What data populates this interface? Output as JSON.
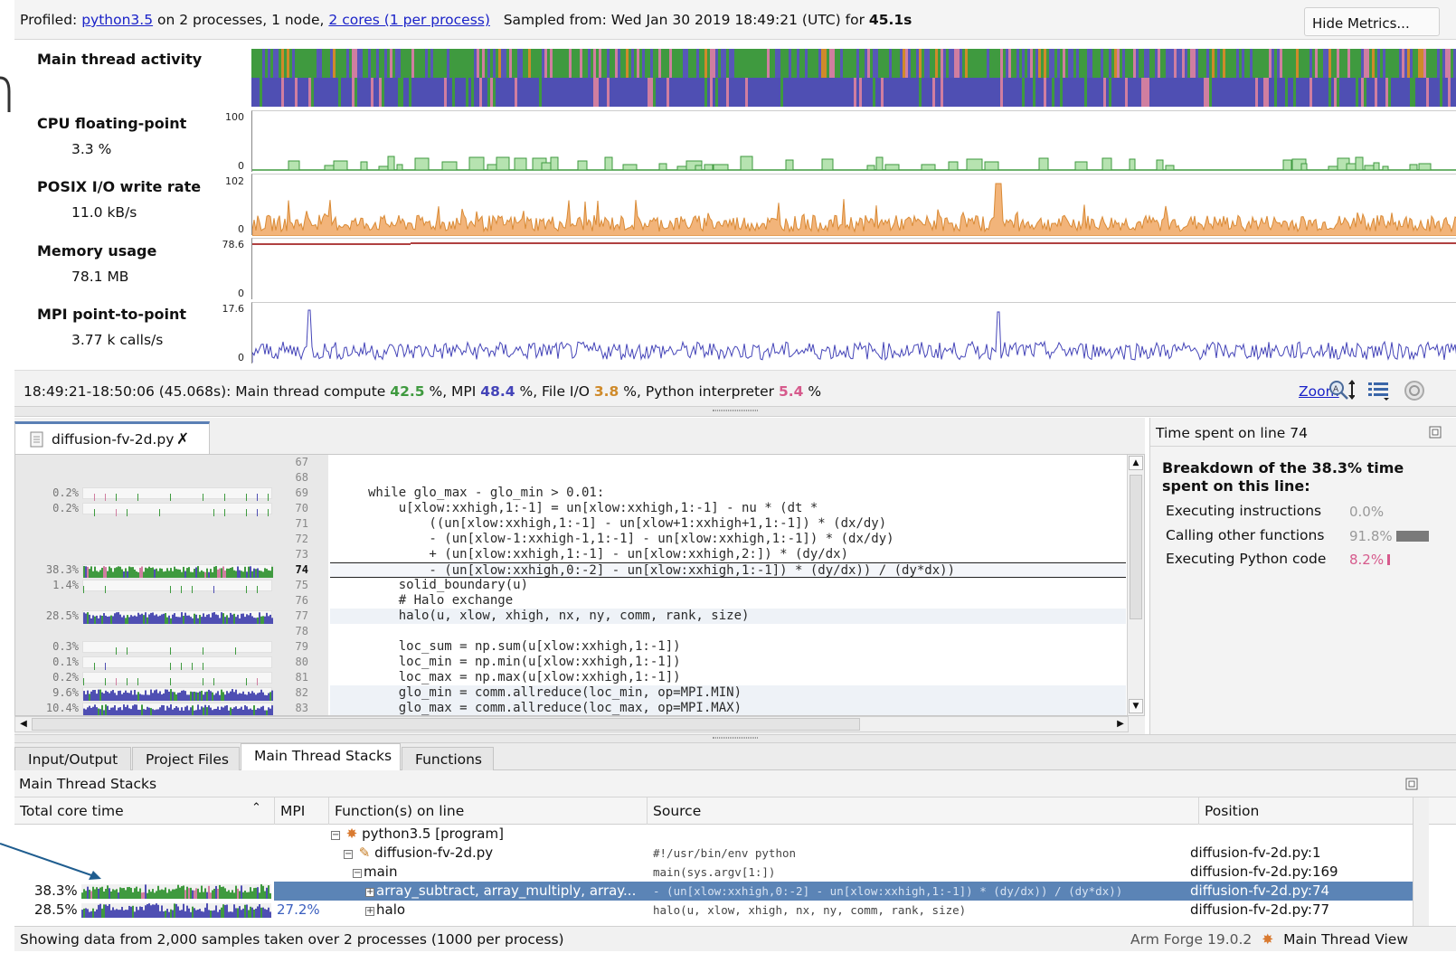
{
  "header": {
    "profiled_label": "Profiled:",
    "program_link": "python3.5",
    "proc_text": "on 2 processes, 1 node,",
    "cores_link": "2 cores (1 per process)",
    "sampled_text": "Sampled from: Wed Jan 30 2019 18:49:21 (UTC) for",
    "duration": "45.1s",
    "hide_metrics_label": "Hide Metrics..."
  },
  "metrics": [
    {
      "title": "Main thread activity",
      "value": "",
      "max": "",
      "min": ""
    },
    {
      "title": "CPU floating-point",
      "value": "3.3 %",
      "max": "100",
      "min": "0"
    },
    {
      "title": "POSIX I/O write rate",
      "value": "11.0 kB/s",
      "max": "102",
      "min": "0"
    },
    {
      "title": "Memory usage",
      "value": "78.1 MB",
      "max": "78.6",
      "min": "0"
    },
    {
      "title": "MPI point-to-point",
      "value": "3.77 k calls/s",
      "max": "17.6",
      "min": "0"
    }
  ],
  "summary": {
    "range": "18:49:21-18:50:06 (45.068s): Main thread compute",
    "compute": "42.5",
    "mpi_label": "%, MPI",
    "mpi": "48.4",
    "io_label": "%, File I/O",
    "io": "3.8",
    "py_label": "%, Python interpreter",
    "py": "5.4",
    "pct_end": "%",
    "zoom_label": "Zoom"
  },
  "editor": {
    "file_tab": "diffusion-fv-2d.py",
    "lines": [
      {
        "no": "67",
        "pct": "",
        "code": ""
      },
      {
        "no": "68",
        "pct": "",
        "code": ""
      },
      {
        "no": "69",
        "pct": "0.2%",
        "code": "while glo_max - glo_min > 0.01:"
      },
      {
        "no": "70",
        "pct": "0.2%",
        "code": "    u[xlow:xxhigh,1:-1] = un[xlow:xxhigh,1:-1] - nu * (dt *"
      },
      {
        "no": "71",
        "pct": "",
        "code": "        ((un[xlow:xxhigh,1:-1] - un[xlow+1:xxhigh+1,1:-1]) * (dx/dy)"
      },
      {
        "no": "72",
        "pct": "",
        "code": "        - (un[xlow-1:xxhigh-1,1:-1] - un[xlow:xxhigh,1:-1]) * (dx/dy)"
      },
      {
        "no": "73",
        "pct": "",
        "code": "        + (un[xlow:xxhigh,1:-1] - un[xlow:xxhigh,2:]) * (dy/dx)"
      },
      {
        "no": "74",
        "pct": "38.3%",
        "code": "        - (un[xlow:xxhigh,0:-2] - un[xlow:xxhigh,1:-1]) * (dy/dx)) / (dy*dx))"
      },
      {
        "no": "75",
        "pct": "1.4%",
        "code": "    solid_boundary(u)"
      },
      {
        "no": "76",
        "pct": "",
        "code": "    # Halo exchange"
      },
      {
        "no": "77",
        "pct": "28.5%",
        "code": "    halo(u, xlow, xhigh, nx, ny, comm, rank, size)"
      },
      {
        "no": "78",
        "pct": "",
        "code": ""
      },
      {
        "no": "79",
        "pct": "0.3%",
        "code": "    loc_sum = np.sum(u[xlow:xxhigh,1:-1])"
      },
      {
        "no": "80",
        "pct": "0.1%",
        "code": "    loc_min = np.min(u[xlow:xxhigh,1:-1])"
      },
      {
        "no": "81",
        "pct": "0.2%",
        "code": "    loc_max = np.max(u[xlow:xxhigh,1:-1])"
      },
      {
        "no": "82",
        "pct": "9.6%",
        "code": "    glo_min = comm.allreduce(loc_min, op=MPI.MIN)"
      },
      {
        "no": "83",
        "pct": "10.4%",
        "code": "    glo_max = comm.allreduce(loc_max, op=MPI.MAX)"
      }
    ]
  },
  "right_panel": {
    "title": "Time spent on line 74",
    "heading": "Breakdown of the 38.3% time spent on this line:",
    "rows": [
      {
        "label": "Executing instructions",
        "value": "0.0%"
      },
      {
        "label": "Calling other functions",
        "value": "91.8%"
      },
      {
        "label": "Executing Python code",
        "value": "8.2%"
      }
    ]
  },
  "bottom_tabs": [
    "Input/Output",
    "Project Files",
    "Main Thread Stacks",
    "Functions"
  ],
  "stacks": {
    "title": "Main Thread Stacks",
    "columns": [
      "Total core time",
      "MPI",
      "Function(s) on line",
      "Source",
      "Position"
    ],
    "rows": [
      {
        "total": "",
        "mpi": "",
        "func": "python3.5 [program]",
        "source": "",
        "position": ""
      },
      {
        "total": "",
        "mpi": "",
        "func": "diffusion-fv-2d.py",
        "source": "#!/usr/bin/env python",
        "position": "diffusion-fv-2d.py:1"
      },
      {
        "total": "",
        "mpi": "",
        "func": "main",
        "source": "main(sys.argv[1:])",
        "position": "diffusion-fv-2d.py:169"
      },
      {
        "total": "38.3%",
        "mpi": "",
        "func": "array_subtract, array_multiply, array...",
        "source": "- (un[xlow:xxhigh,0:-2] - un[xlow:xxhigh,1:-1]) * (dy/dx)) / (dy*dx))",
        "position": "diffusion-fv-2d.py:74"
      },
      {
        "total": "28.5%",
        "mpi": "27.2%",
        "func": "halo",
        "source": "halo(u, xlow, xhigh, nx, ny, comm, rank, size)",
        "position": "diffusion-fv-2d.py:77"
      }
    ]
  },
  "status": {
    "left": "Showing data from 2,000 samples taken over 2 processes (1000 per process)",
    "right_product": "Arm Forge 19.0.2",
    "right_view": "Main Thread View"
  },
  "colors": {
    "compute_green": "#3f9a3f",
    "mpi_blue": "#4444b8",
    "io_orange": "#cf8a2a",
    "python_pink": "#d65a8c",
    "selection": "#5b84b6"
  }
}
